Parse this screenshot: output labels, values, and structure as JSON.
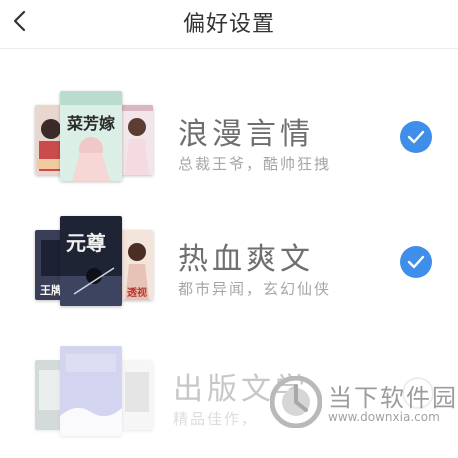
{
  "header": {
    "title": "偏好设置",
    "back_icon": "chevron-left-icon"
  },
  "preferences": [
    {
      "title": "浪漫言情",
      "subtitle": "总裁王爷，酷帅狂拽",
      "selected": true,
      "cover_text": "菜芳嫁"
    },
    {
      "title": "热血爽文",
      "subtitle": "都市异闻，玄幻仙侠",
      "selected": true,
      "cover_text": "元尊",
      "left_cover_text": "王牌",
      "right_cover_text": "透视"
    },
    {
      "title": "出版文学",
      "subtitle": "精品佳作，",
      "selected": false
    }
  ],
  "watermark": {
    "brand": "当下软件园",
    "url": "www.downxia.com"
  },
  "colors": {
    "accent": "#3f8eea",
    "title_text": "#6f6f6f",
    "subtitle_text": "#a6a6a6"
  }
}
